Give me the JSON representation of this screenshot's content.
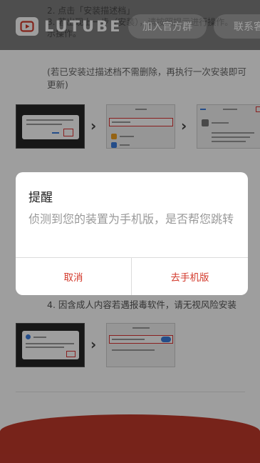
{
  "header": {
    "logo_text": "LUTUBE",
    "join_button": "加入官方群",
    "contact_button": "联系客"
  },
  "background": {
    "step3_lines": [
      "2. 点击「安装描述档」",
      "3. 若出现上一步（安装），请按照提示进行操作。",
      "示操作。"
    ],
    "reinstall_note": "(若已安装过描述档不需删除，再执行一次安装即可更新)",
    "step4_text": "4. 因含成人内容若遇报毒软件，请无视风险安装"
  },
  "modal": {
    "title": "提醒",
    "message": "侦测到您的装置为手机版，是否帮您跳转",
    "cancel_label": "取消",
    "confirm_label": "去手机版"
  },
  "colors": {
    "accent": "#d33a2c",
    "overlay": "rgba(0,0,0,0.38)"
  }
}
